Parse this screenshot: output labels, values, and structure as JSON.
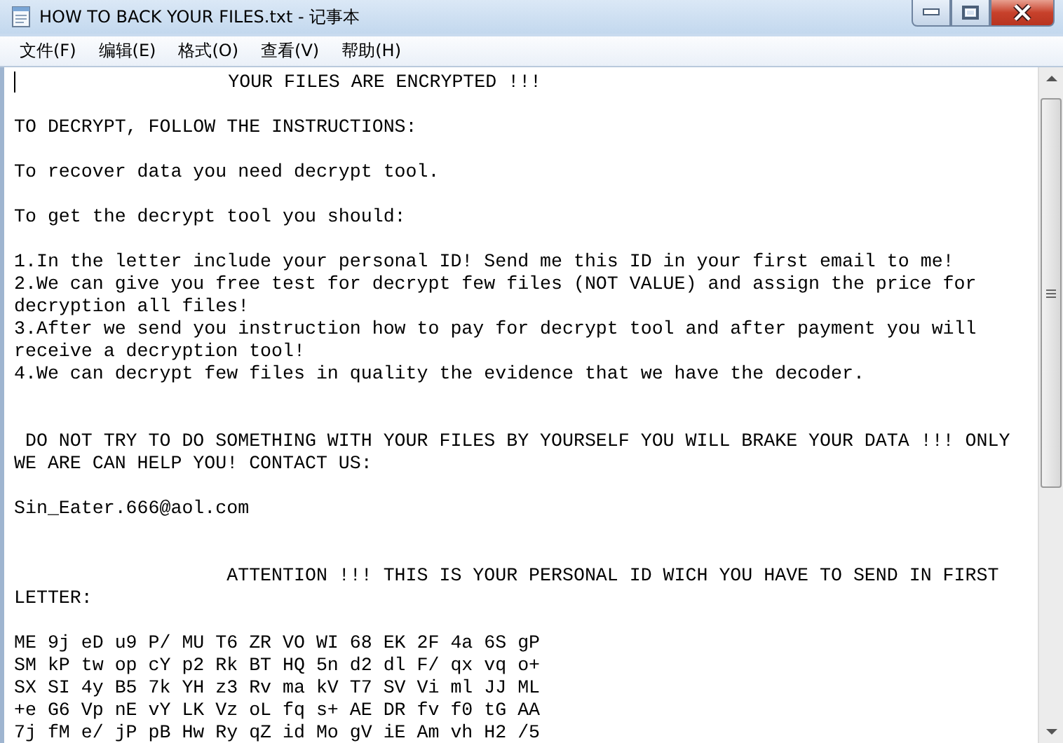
{
  "window": {
    "title": "HOW TO BACK YOUR FILES.txt - 记事本"
  },
  "menu": [
    "文件(F)",
    "编辑(E)",
    "格式(O)",
    "查看(V)",
    "帮助(H)"
  ],
  "document": {
    "caret": true,
    "paragraphs": [
      {
        "kind": "first",
        "lines": [
          "                   YOUR FILES ARE ENCRYPTED !!!"
        ]
      },
      {
        "kind": "after-blank",
        "lines": [
          "TO DECRYPT, FOLLOW THE INSTRUCTIONS:"
        ]
      },
      {
        "kind": "after-blank",
        "lines": [
          "To recover data you need decrypt tool."
        ]
      },
      {
        "kind": "after-blank",
        "lines": [
          "To get the decrypt tool you should:"
        ]
      },
      {
        "kind": "after-blank",
        "lines": [
          "1.In the letter include your personal ID! Send me this ID in your first email to me!"
        ]
      },
      {
        "kind": "next",
        "lines": [
          "2.We can give you free test for decrypt few files (NOT VALUE) and assign the price for",
          "decryption all files!"
        ]
      },
      {
        "kind": "next",
        "lines": [
          "3.After we send you instruction how to pay for decrypt tool and after payment you will",
          "receive a decryption tool!"
        ]
      },
      {
        "kind": "next",
        "lines": [
          "4.We can decrypt few files in quality the evidence that we have the decoder."
        ]
      },
      {
        "kind": "after-two-blanks",
        "lines": [
          " DO NOT TRY TO DO SOMETHING WITH YOUR FILES BY YOURSELF YOU WILL BRAKE YOUR DATA !!! ONLY",
          "WE ARE CAN HELP YOU! CONTACT US:"
        ]
      },
      {
        "kind": "after-blank",
        "lines": [
          "Sin_Eater.666@aol.com"
        ]
      },
      {
        "kind": "after-two-blanks",
        "lines": [
          "                   ATTENTION !!! THIS IS YOUR PERSONAL ID WICH YOU HAVE TO SEND IN FIRST",
          "LETTER:"
        ]
      },
      {
        "kind": "after-blank",
        "lines": [
          "ME 9j eD u9 P/ MU T6 ZR VO WI 68 EK 2F 4a 6S gP",
          "SM kP tw op cY p2 Rk BT HQ 5n d2 dl F/ qx vq o+",
          "SX SI 4y B5 7k YH z3 Rv ma kV T7 SV Vi ml JJ ML",
          "+e G6 Vp nE vY LK Vz oL fq s+ AE DR fv f0 tG AA",
          "7j fM e/ jP pB Hw Ry qZ id Mo gV iE Am vh H2 /5"
        ]
      }
    ]
  }
}
